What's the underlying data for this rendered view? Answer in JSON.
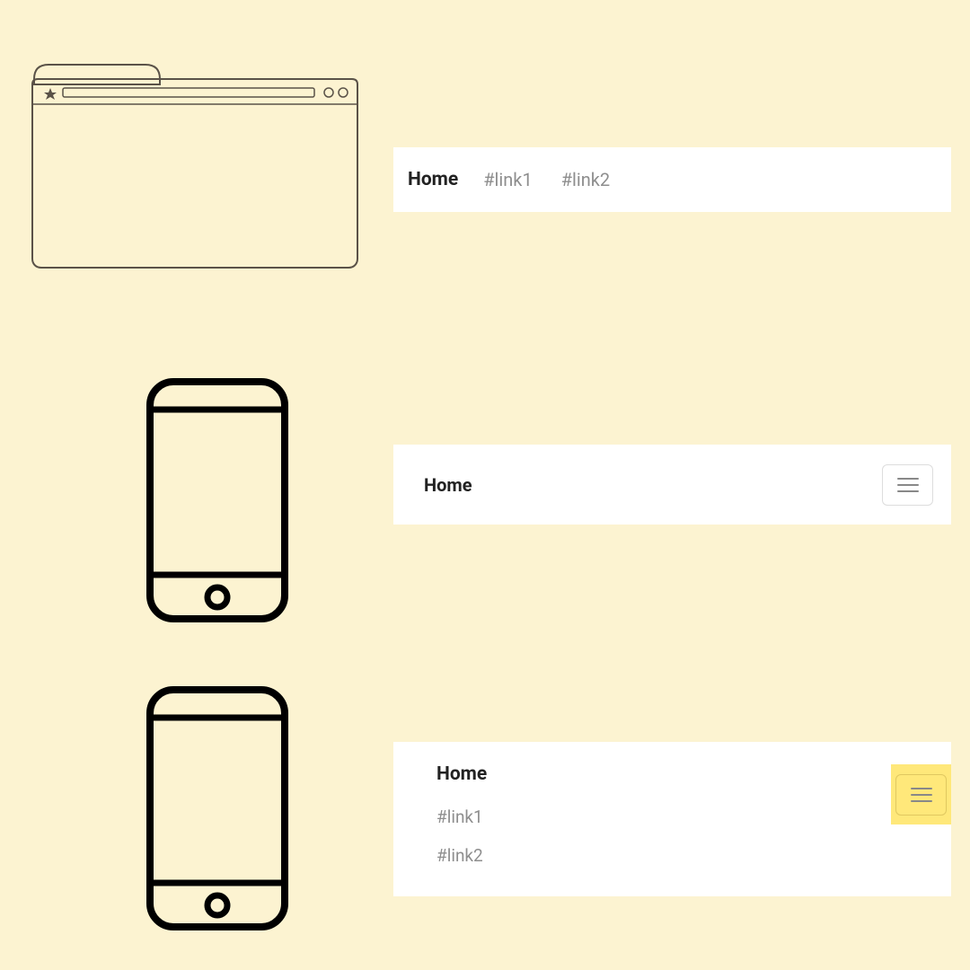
{
  "navbar1": {
    "brand": "Home",
    "links": [
      "#link1",
      "#link2"
    ]
  },
  "navbar2": {
    "brand": "Home"
  },
  "navbar3": {
    "brand": "Home",
    "links": [
      "#link1",
      "#link2"
    ]
  }
}
